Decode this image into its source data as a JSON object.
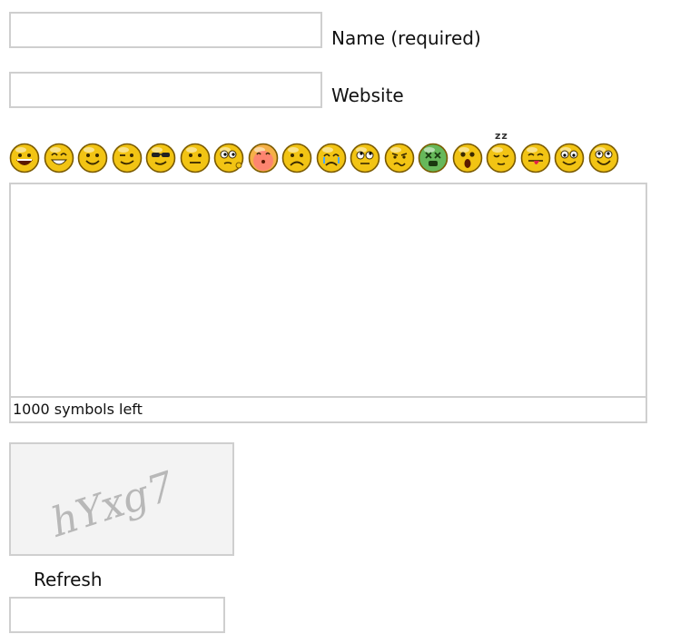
{
  "form": {
    "name_label": "Name (required)",
    "name_value": "",
    "website_label": "Website",
    "website_value": "",
    "message_value": "",
    "counter_text": "1000 symbols left",
    "refresh_label": "Refresh",
    "captcha_value": "",
    "captcha_image_text": "hYxg7"
  },
  "smileys": [
    {
      "name": "big-grin-icon"
    },
    {
      "name": "grin-icon"
    },
    {
      "name": "smile-icon"
    },
    {
      "name": "wink-icon"
    },
    {
      "name": "cool-icon"
    },
    {
      "name": "neutral-icon"
    },
    {
      "name": "thinking-icon"
    },
    {
      "name": "blush-icon"
    },
    {
      "name": "sad-icon"
    },
    {
      "name": "cry-icon"
    },
    {
      "name": "eyeroll-icon"
    },
    {
      "name": "confused-icon"
    },
    {
      "name": "sick-icon"
    },
    {
      "name": "surprised-icon"
    },
    {
      "name": "sleepy-icon",
      "caption": "zz"
    },
    {
      "name": "tongue-icon"
    },
    {
      "name": "happy-eyes-icon"
    },
    {
      "name": "laugh-icon"
    }
  ],
  "colors": {
    "border": "#cfcfcf",
    "smiley_yellow": "#f2c414",
    "smiley_outline": "#7a5a00",
    "blush": "#ff7a7a",
    "sick_green": "#66b85a"
  }
}
